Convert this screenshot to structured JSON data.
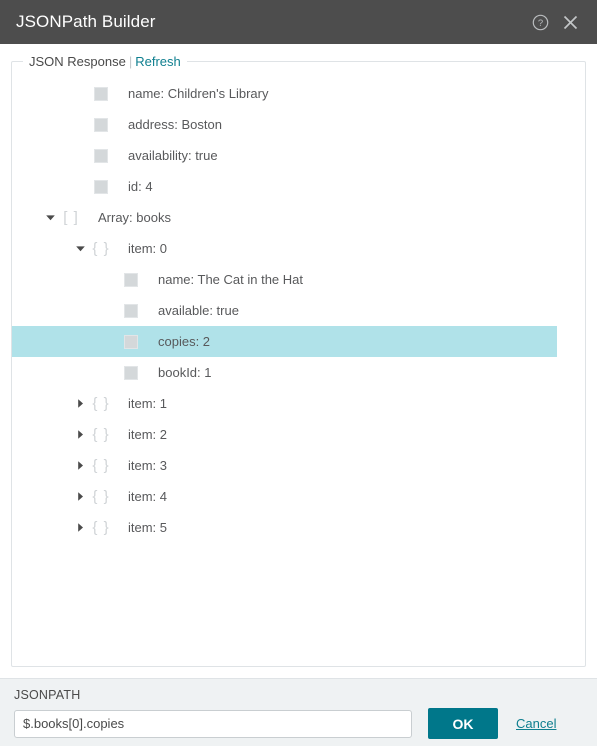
{
  "window": {
    "title": "JSONPath Builder",
    "help_icon": "help-circle-icon",
    "close_icon": "close-icon"
  },
  "panel": {
    "legend_label": "JSON Response",
    "legend_separator": "|",
    "refresh_label": "Refresh"
  },
  "tree": {
    "rows": [
      {
        "label": "name: Children's Library",
        "type": "leaf",
        "depth": 1,
        "expanded": null,
        "selected": false,
        "icon": "leaf-square-icon"
      },
      {
        "label": "address: Boston",
        "type": "leaf",
        "depth": 1,
        "expanded": null,
        "selected": false,
        "icon": "leaf-square-icon"
      },
      {
        "label": "availability: true",
        "type": "leaf",
        "depth": 1,
        "expanded": null,
        "selected": false,
        "icon": "leaf-square-icon"
      },
      {
        "label": "id: 4",
        "type": "leaf",
        "depth": 1,
        "expanded": null,
        "selected": false,
        "icon": "leaf-square-icon"
      },
      {
        "label": "Array: books",
        "type": "array",
        "depth": 0,
        "expanded": true,
        "selected": false,
        "icon": "array-brackets-icon"
      },
      {
        "label": "item: 0",
        "type": "object",
        "depth": 1,
        "expanded": true,
        "selected": false,
        "icon": "object-braces-icon"
      },
      {
        "label": "name: The Cat in the Hat",
        "type": "leaf",
        "depth": 2,
        "expanded": null,
        "selected": false,
        "icon": "leaf-square-icon"
      },
      {
        "label": "available: true",
        "type": "leaf",
        "depth": 2,
        "expanded": null,
        "selected": false,
        "icon": "leaf-square-icon"
      },
      {
        "label": "copies: 2",
        "type": "leaf",
        "depth": 2,
        "expanded": null,
        "selected": true,
        "icon": "leaf-square-icon"
      },
      {
        "label": "bookId: 1",
        "type": "leaf",
        "depth": 2,
        "expanded": null,
        "selected": false,
        "icon": "leaf-square-icon"
      },
      {
        "label": "item: 1",
        "type": "object",
        "depth": 1,
        "expanded": false,
        "selected": false,
        "icon": "object-braces-icon"
      },
      {
        "label": "item: 2",
        "type": "object",
        "depth": 1,
        "expanded": false,
        "selected": false,
        "icon": "object-braces-icon"
      },
      {
        "label": "item: 3",
        "type": "object",
        "depth": 1,
        "expanded": false,
        "selected": false,
        "icon": "object-braces-icon"
      },
      {
        "label": "item: 4",
        "type": "object",
        "depth": 1,
        "expanded": false,
        "selected": false,
        "icon": "object-braces-icon"
      },
      {
        "label": "item: 5",
        "type": "object",
        "depth": 1,
        "expanded": false,
        "selected": false,
        "icon": "object-braces-icon"
      }
    ]
  },
  "footer": {
    "jsonpath_label": "JSONPATH",
    "jsonpath_value": "$.books[0].copies",
    "jsonpath_placeholder": "",
    "ok_label": "OK",
    "cancel_label": "Cancel"
  },
  "colors": {
    "titlebar": "#4d4d4d",
    "accent_teal": "#00778a",
    "link_teal": "#0f7f8f",
    "selection": "#b0e2e9",
    "footer_bg": "#eff2f3",
    "panel_border": "#dfe3e6",
    "text": "#58595b",
    "leaf_icon": "#d4d8da"
  }
}
